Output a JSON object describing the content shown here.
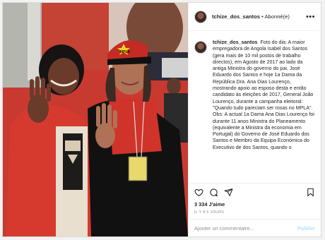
{
  "post": {
    "username": "tchize_dos_santos",
    "separator": "•",
    "follow_status": "Abonné(e)",
    "more_icon": "more-horizontal-icon",
    "caption_username": "tchize_dos_santos",
    "caption_text": "Foto do dia: A maior empregadora de Angola Isabel dos Santos (gera mais de 10 mil postos de trabalho directos), em Agosto de 2017 ao lado da antiga Ministra do governo do pai, José Eduardo dos Santos e hoje 1a Dama da República Dra. Ana Dias Lourenço, mostrando apoio ao esposo desta e então candidato às eleições de 2017, General João Lourenço, durante a campanha eleitoral: \"Quando tudo pareciam ser rosas no MPLA\". Obs: A actual 1a Dama Ana Dias Lourenço foi durante 11 anos Ministra do Planeamento (equivalente a Ministra da economia em Portugal) do Governo de José Eduardo dos Santos e Membro da Equipa Económica do Executivo de dos Santos, quando o",
    "likes": "3 334 J'aime",
    "time": "IL Y A 5 JOURS",
    "comment_placeholder": "Ajouter un commentaire...",
    "publish_label": "Publier",
    "cap_logo": "MPLA",
    "icons": [
      "heart-icon",
      "comment-icon",
      "share-icon",
      "bookmark-icon"
    ],
    "colors": {
      "link": "#0095f6",
      "publish_disabled": "#b2dffc",
      "text": "#262626",
      "muted": "#8e8e8e"
    }
  }
}
